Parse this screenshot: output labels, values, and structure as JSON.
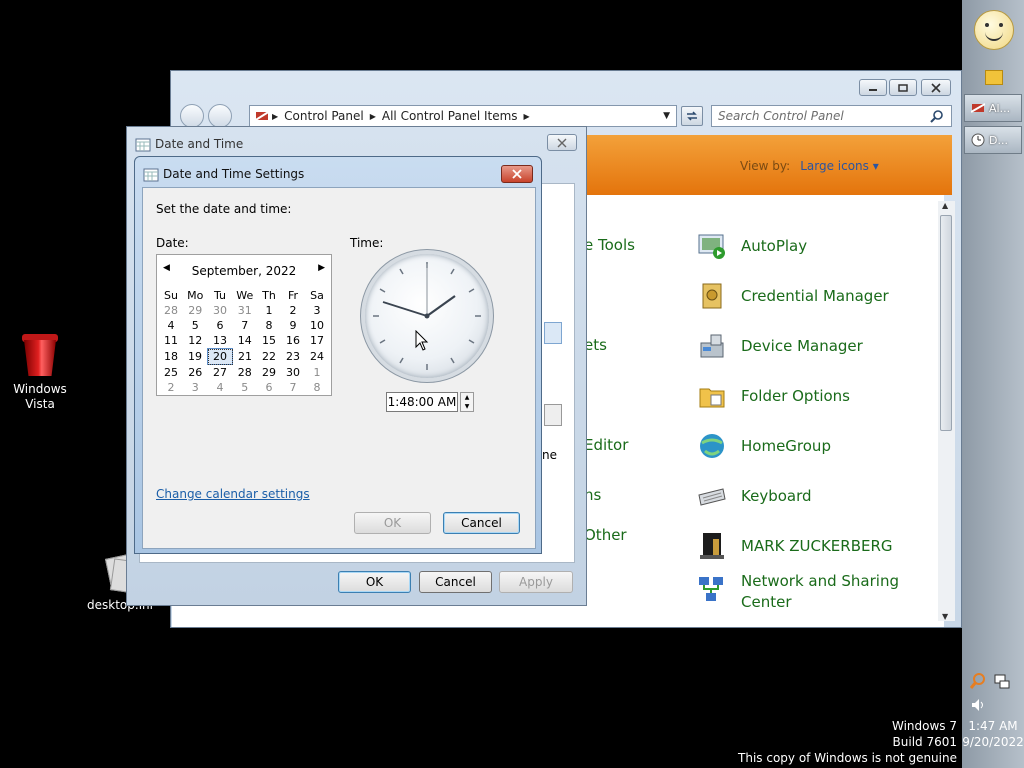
{
  "desktop": {
    "icons": [
      {
        "label": "Windows Vista"
      },
      {
        "label": "desktop.ini"
      }
    ],
    "watermark": [
      "Windows 7",
      "Build 7601",
      "This copy of Windows is not genuine"
    ]
  },
  "taskbar": {
    "buttons": [
      {
        "label": "Al..."
      },
      {
        "label": "D..."
      }
    ],
    "clock": {
      "time": "1:47 AM",
      "date": "9/20/2022"
    }
  },
  "control_panel": {
    "breadcrumb": [
      "Control Panel",
      "All Control Panel Items"
    ],
    "search_placeholder": "Search Control Panel",
    "view_by_label": "View by:",
    "view_by_value": "Large icons",
    "items": [
      {
        "label": "AutoPlay",
        "icon": "autoplay-icon"
      },
      {
        "label": "Credential Manager",
        "icon": "credential-manager-icon"
      },
      {
        "label": "Device Manager",
        "icon": "device-manager-icon"
      },
      {
        "label": "Folder Options",
        "icon": "folder-options-icon"
      },
      {
        "label": "HomeGroup",
        "icon": "homegroup-icon"
      },
      {
        "label": "Keyboard",
        "icon": "keyboard-icon"
      },
      {
        "label": "MARK ZUCKERBERG",
        "icon": "user-icon"
      },
      {
        "label": "Network and Sharing",
        "label2": "Center",
        "icon": "network-icon"
      }
    ],
    "partial_items": [
      "e Tools",
      "ets",
      "Editor",
      "ns",
      "Other"
    ]
  },
  "date_time_window": {
    "title": "Date and Time",
    "partial_text": "ne",
    "buttons": {
      "ok": "OK",
      "cancel": "Cancel",
      "apply": "Apply"
    }
  },
  "date_time_settings": {
    "title": "Date and Time Settings",
    "prompt": "Set the date and time:",
    "date_label": "Date:",
    "time_label": "Time:",
    "calendar": {
      "month_year": "September, 2022",
      "weekdays": [
        "Su",
        "Mo",
        "Tu",
        "We",
        "Th",
        "Fr",
        "Sa"
      ],
      "weeks": [
        [
          "28",
          "29",
          "30",
          "31",
          "1",
          "2",
          "3"
        ],
        [
          "4",
          "5",
          "6",
          "7",
          "8",
          "9",
          "10"
        ],
        [
          "11",
          "12",
          "13",
          "14",
          "15",
          "16",
          "17"
        ],
        [
          "18",
          "19",
          "20",
          "21",
          "22",
          "23",
          "24"
        ],
        [
          "25",
          "26",
          "27",
          "28",
          "29",
          "30",
          "1"
        ],
        [
          "2",
          "3",
          "4",
          "5",
          "6",
          "7",
          "8"
        ]
      ],
      "selected": "20"
    },
    "time_value": "1:48:00 AM",
    "change_calendar_link": "Change calendar settings",
    "buttons": {
      "ok": "OK",
      "cancel": "Cancel"
    }
  }
}
